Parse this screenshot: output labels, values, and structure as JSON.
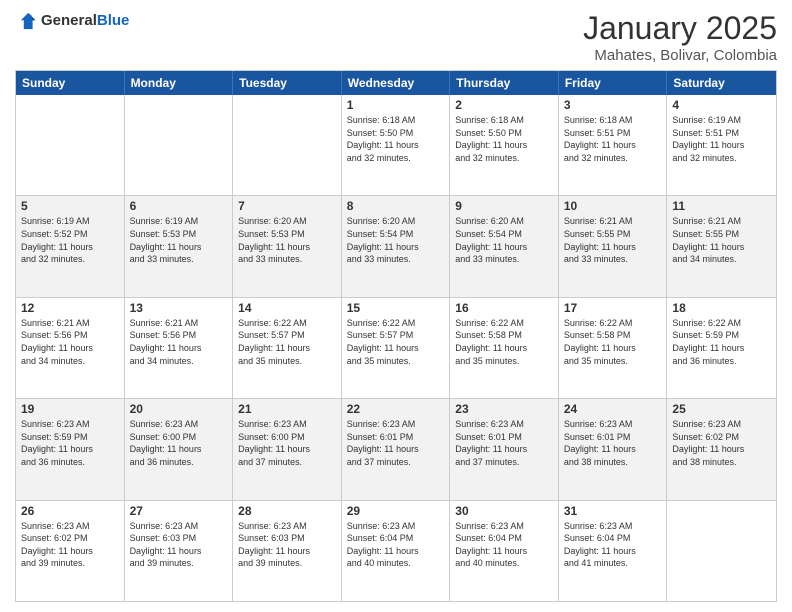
{
  "header": {
    "logo_general": "General",
    "logo_blue": "Blue",
    "month": "January 2025",
    "location": "Mahates, Bolivar, Colombia"
  },
  "days_of_week": [
    "Sunday",
    "Monday",
    "Tuesday",
    "Wednesday",
    "Thursday",
    "Friday",
    "Saturday"
  ],
  "rows": [
    [
      {
        "day": "",
        "info": ""
      },
      {
        "day": "",
        "info": ""
      },
      {
        "day": "",
        "info": ""
      },
      {
        "day": "1",
        "info": "Sunrise: 6:18 AM\nSunset: 5:50 PM\nDaylight: 11 hours\nand 32 minutes."
      },
      {
        "day": "2",
        "info": "Sunrise: 6:18 AM\nSunset: 5:50 PM\nDaylight: 11 hours\nand 32 minutes."
      },
      {
        "day": "3",
        "info": "Sunrise: 6:18 AM\nSunset: 5:51 PM\nDaylight: 11 hours\nand 32 minutes."
      },
      {
        "day": "4",
        "info": "Sunrise: 6:19 AM\nSunset: 5:51 PM\nDaylight: 11 hours\nand 32 minutes."
      }
    ],
    [
      {
        "day": "5",
        "info": "Sunrise: 6:19 AM\nSunset: 5:52 PM\nDaylight: 11 hours\nand 32 minutes."
      },
      {
        "day": "6",
        "info": "Sunrise: 6:19 AM\nSunset: 5:53 PM\nDaylight: 11 hours\nand 33 minutes."
      },
      {
        "day": "7",
        "info": "Sunrise: 6:20 AM\nSunset: 5:53 PM\nDaylight: 11 hours\nand 33 minutes."
      },
      {
        "day": "8",
        "info": "Sunrise: 6:20 AM\nSunset: 5:54 PM\nDaylight: 11 hours\nand 33 minutes."
      },
      {
        "day": "9",
        "info": "Sunrise: 6:20 AM\nSunset: 5:54 PM\nDaylight: 11 hours\nand 33 minutes."
      },
      {
        "day": "10",
        "info": "Sunrise: 6:21 AM\nSunset: 5:55 PM\nDaylight: 11 hours\nand 33 minutes."
      },
      {
        "day": "11",
        "info": "Sunrise: 6:21 AM\nSunset: 5:55 PM\nDaylight: 11 hours\nand 34 minutes."
      }
    ],
    [
      {
        "day": "12",
        "info": "Sunrise: 6:21 AM\nSunset: 5:56 PM\nDaylight: 11 hours\nand 34 minutes."
      },
      {
        "day": "13",
        "info": "Sunrise: 6:21 AM\nSunset: 5:56 PM\nDaylight: 11 hours\nand 34 minutes."
      },
      {
        "day": "14",
        "info": "Sunrise: 6:22 AM\nSunset: 5:57 PM\nDaylight: 11 hours\nand 35 minutes."
      },
      {
        "day": "15",
        "info": "Sunrise: 6:22 AM\nSunset: 5:57 PM\nDaylight: 11 hours\nand 35 minutes."
      },
      {
        "day": "16",
        "info": "Sunrise: 6:22 AM\nSunset: 5:58 PM\nDaylight: 11 hours\nand 35 minutes."
      },
      {
        "day": "17",
        "info": "Sunrise: 6:22 AM\nSunset: 5:58 PM\nDaylight: 11 hours\nand 35 minutes."
      },
      {
        "day": "18",
        "info": "Sunrise: 6:22 AM\nSunset: 5:59 PM\nDaylight: 11 hours\nand 36 minutes."
      }
    ],
    [
      {
        "day": "19",
        "info": "Sunrise: 6:23 AM\nSunset: 5:59 PM\nDaylight: 11 hours\nand 36 minutes."
      },
      {
        "day": "20",
        "info": "Sunrise: 6:23 AM\nSunset: 6:00 PM\nDaylight: 11 hours\nand 36 minutes."
      },
      {
        "day": "21",
        "info": "Sunrise: 6:23 AM\nSunset: 6:00 PM\nDaylight: 11 hours\nand 37 minutes."
      },
      {
        "day": "22",
        "info": "Sunrise: 6:23 AM\nSunset: 6:01 PM\nDaylight: 11 hours\nand 37 minutes."
      },
      {
        "day": "23",
        "info": "Sunrise: 6:23 AM\nSunset: 6:01 PM\nDaylight: 11 hours\nand 37 minutes."
      },
      {
        "day": "24",
        "info": "Sunrise: 6:23 AM\nSunset: 6:01 PM\nDaylight: 11 hours\nand 38 minutes."
      },
      {
        "day": "25",
        "info": "Sunrise: 6:23 AM\nSunset: 6:02 PM\nDaylight: 11 hours\nand 38 minutes."
      }
    ],
    [
      {
        "day": "26",
        "info": "Sunrise: 6:23 AM\nSunset: 6:02 PM\nDaylight: 11 hours\nand 39 minutes."
      },
      {
        "day": "27",
        "info": "Sunrise: 6:23 AM\nSunset: 6:03 PM\nDaylight: 11 hours\nand 39 minutes."
      },
      {
        "day": "28",
        "info": "Sunrise: 6:23 AM\nSunset: 6:03 PM\nDaylight: 11 hours\nand 39 minutes."
      },
      {
        "day": "29",
        "info": "Sunrise: 6:23 AM\nSunset: 6:04 PM\nDaylight: 11 hours\nand 40 minutes."
      },
      {
        "day": "30",
        "info": "Sunrise: 6:23 AM\nSunset: 6:04 PM\nDaylight: 11 hours\nand 40 minutes."
      },
      {
        "day": "31",
        "info": "Sunrise: 6:23 AM\nSunset: 6:04 PM\nDaylight: 11 hours\nand 41 minutes."
      },
      {
        "day": "",
        "info": ""
      }
    ]
  ]
}
